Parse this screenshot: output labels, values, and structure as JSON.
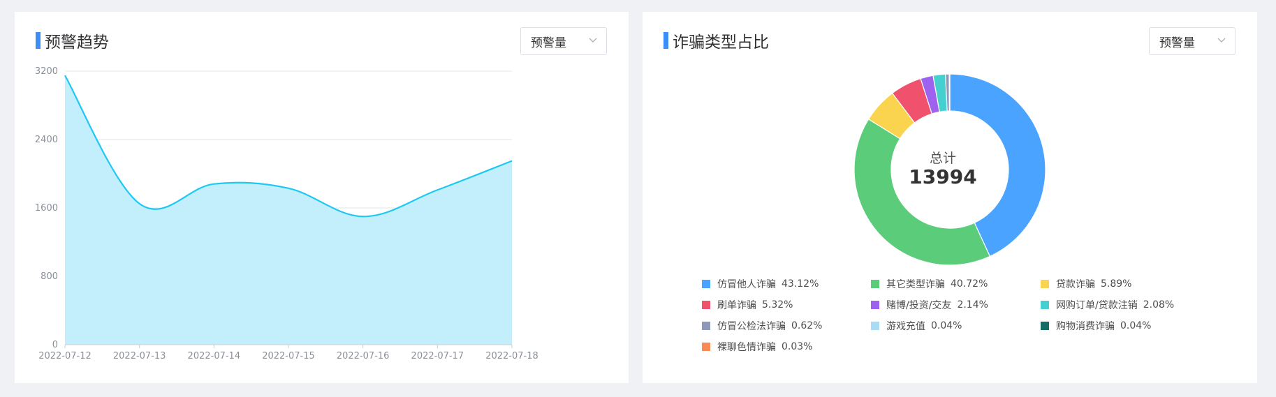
{
  "left_panel": {
    "title": "预警趋势",
    "select_value": "预警量"
  },
  "right_panel": {
    "title": "诈骗类型占比",
    "select_value": "预警量",
    "center_label": "总计",
    "center_value": "13994"
  },
  "colors": {
    "accent": "#3a8ef6",
    "line": "#1ec8f2",
    "area": "#c3effc"
  },
  "chart_data": [
    {
      "type": "area",
      "title": "预警趋势",
      "x": [
        "2022-07-12",
        "2022-07-13",
        "2022-07-14",
        "2022-07-15",
        "2022-07-16",
        "2022-07-17",
        "2022-07-18"
      ],
      "values": [
        3150,
        1650,
        1880,
        1830,
        1500,
        1810,
        2150
      ],
      "ylim": [
        0,
        3200
      ],
      "yticks": [
        "0",
        "800",
        "1600",
        "2400",
        "3200"
      ],
      "grid": true
    },
    {
      "type": "pie",
      "title": "诈骗类型占比",
      "total": 13994,
      "slices": [
        {
          "name": "仿冒他人诈骗",
          "pct": "43.12%",
          "value": 43.12,
          "color": "#4aa4ff"
        },
        {
          "name": "其它类型诈骗",
          "pct": "40.72%",
          "value": 40.72,
          "color": "#5bcd7a"
        },
        {
          "name": "贷款诈骗",
          "pct": "5.89%",
          "value": 5.89,
          "color": "#fad44e"
        },
        {
          "name": "刷单诈骗",
          "pct": "5.32%",
          "value": 5.32,
          "color": "#f0516d"
        },
        {
          "name": "赌博/投资/交友",
          "pct": "2.14%",
          "value": 2.14,
          "color": "#9e63ee"
        },
        {
          "name": "网购订单/贷款注销",
          "pct": "2.08%",
          "value": 2.08,
          "color": "#45cfcf"
        },
        {
          "name": "仿冒公检法诈骗",
          "pct": "0.62%",
          "value": 0.62,
          "color": "#8e98bd"
        },
        {
          "name": "游戏充值",
          "pct": "0.04%",
          "value": 0.04,
          "color": "#a8dcf5"
        },
        {
          "name": "购物消费诈骗",
          "pct": "0.04%",
          "value": 0.04,
          "color": "#176b66"
        },
        {
          "name": "裸聊色情诈骗",
          "pct": "0.03%",
          "value": 0.03,
          "color": "#f98a55"
        }
      ]
    }
  ]
}
